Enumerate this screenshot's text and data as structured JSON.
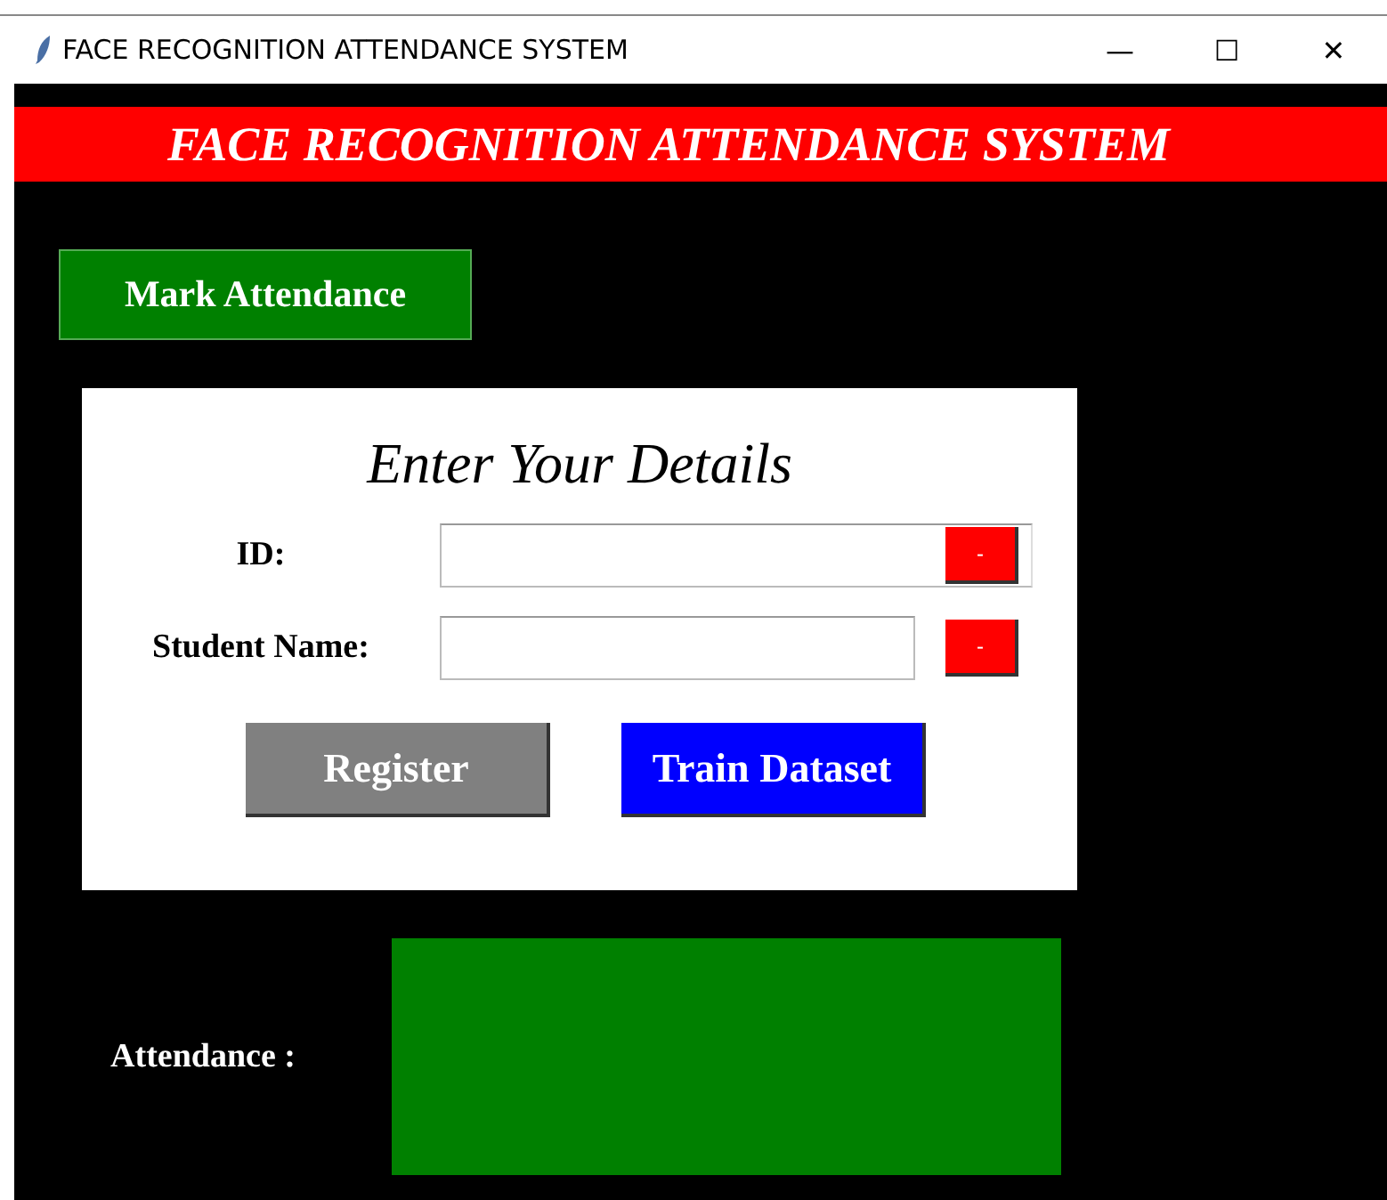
{
  "window": {
    "title": "FACE RECOGNITION ATTENDANCE SYSTEM",
    "controls": [
      "—",
      "☐",
      "✕"
    ]
  },
  "banner": {
    "title": "FACE RECOGNITION ATTENDANCE SYSTEM"
  },
  "mark_button": {
    "label": "Mark Attendance"
  },
  "details": {
    "heading": "Enter Your Details",
    "fields": [
      {
        "label": "ID:",
        "clear_button": "-"
      },
      {
        "label": "Student Name:",
        "clear_button": "-"
      }
    ],
    "buttons": [
      {
        "label": "Register",
        "color": "#808080"
      },
      {
        "label": "Train Dataset",
        "color": "#0000ff"
      }
    ]
  },
  "attendance": {
    "label": "Attendance :"
  }
}
